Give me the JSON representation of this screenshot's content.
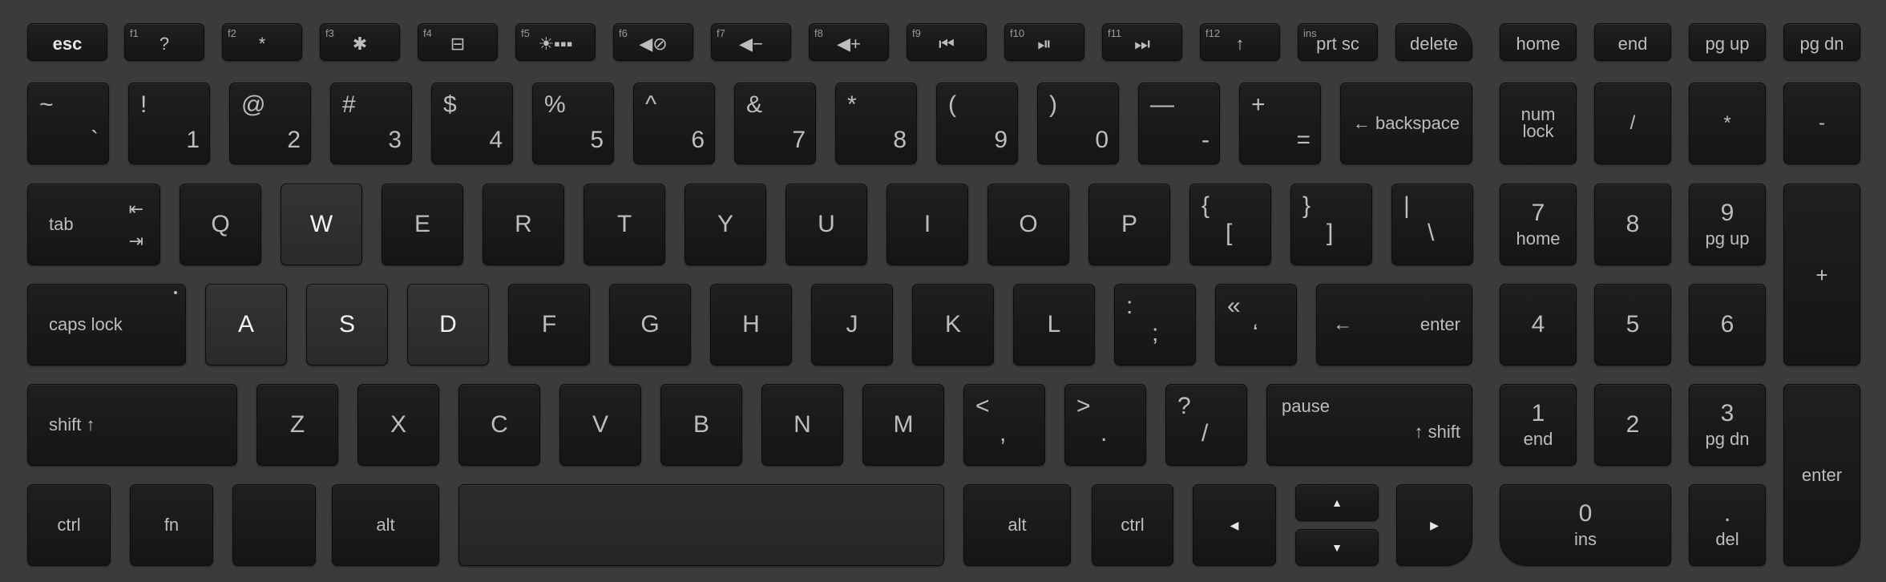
{
  "keyboard": {
    "fn_row": [
      {
        "id": "esc",
        "main": "esc"
      },
      {
        "id": "f1",
        "top": "f1",
        "main": "?"
      },
      {
        "id": "f2",
        "top": "f2",
        "main": "*"
      },
      {
        "id": "f3",
        "top": "f3",
        "main": "✱"
      },
      {
        "id": "f4",
        "top": "f4",
        "main": "⊟"
      },
      {
        "id": "f5",
        "top": "f5",
        "main": "☀▪▪▪"
      },
      {
        "id": "f6",
        "top": "f6",
        "main": "◀⊘"
      },
      {
        "id": "f7",
        "top": "f7",
        "main": "◀−"
      },
      {
        "id": "f8",
        "top": "f8",
        "main": "◀+"
      },
      {
        "id": "f9",
        "top": "f9",
        "main": "⏮"
      },
      {
        "id": "f10",
        "top": "f10",
        "main": "⏯"
      },
      {
        "id": "f11",
        "top": "f11",
        "main": "⏭"
      },
      {
        "id": "f12",
        "top": "f12",
        "main": "↑"
      },
      {
        "id": "ins-prtsc",
        "top": "ins",
        "main": "prt sc"
      },
      {
        "id": "delete",
        "main": "delete"
      },
      {
        "id": "home",
        "main": "home"
      },
      {
        "id": "end",
        "main": "end"
      },
      {
        "id": "pgup",
        "main": "pg up"
      },
      {
        "id": "pgdn",
        "main": "pg dn"
      }
    ],
    "num_row": [
      {
        "id": "backtick",
        "top": "~",
        "bottom": "`"
      },
      {
        "id": "1",
        "top": "!",
        "bottom": "1"
      },
      {
        "id": "2",
        "top": "@",
        "bottom": "2"
      },
      {
        "id": "3",
        "top": "#",
        "bottom": "3"
      },
      {
        "id": "4",
        "top": "$",
        "bottom": "4"
      },
      {
        "id": "5",
        "top": "%",
        "bottom": "5"
      },
      {
        "id": "6",
        "top": "^",
        "bottom": "6"
      },
      {
        "id": "7",
        "top": "&",
        "bottom": "7"
      },
      {
        "id": "8",
        "top": "*",
        "bottom": "8"
      },
      {
        "id": "9",
        "top": "(",
        "bottom": "9"
      },
      {
        "id": "0",
        "top": ")",
        "bottom": "0"
      },
      {
        "id": "minus",
        "top": "—",
        "bottom": "-"
      },
      {
        "id": "equals",
        "top": "+",
        "bottom": "="
      }
    ],
    "backspace": "← backspace",
    "tab": {
      "text": "tab",
      "arrows_top": "⇤",
      "arrows_bottom": "⇥"
    },
    "qrow": [
      "Q",
      "W",
      "E",
      "R",
      "T",
      "Y",
      "U",
      "I",
      "O",
      "P"
    ],
    "qrow_brackets": [
      {
        "id": "lbracket",
        "top": "{",
        "bottom": "["
      },
      {
        "id": "rbracket",
        "top": "}",
        "bottom": "]"
      },
      {
        "id": "backslash",
        "top": "|",
        "bottom": "\\"
      }
    ],
    "caps": "caps lock",
    "arow": [
      "A",
      "S",
      "D",
      "F",
      "G",
      "H",
      "J",
      "K",
      "L"
    ],
    "arow_punct": [
      {
        "id": "semicolon",
        "top": ":",
        "bottom": ";"
      },
      {
        "id": "quote",
        "top": "«",
        "bottom": "‘"
      }
    ],
    "enter": {
      "arrow": "←",
      "text": "enter"
    },
    "shift_left": "shift ↑",
    "zrow": [
      "Z",
      "X",
      "C",
      "V",
      "B",
      "N",
      "M"
    ],
    "zrow_punct": [
      {
        "id": "comma",
        "top": "<",
        "bottom": ","
      },
      {
        "id": "period",
        "top": ">",
        "bottom": "."
      },
      {
        "id": "slash",
        "top": "?",
        "bottom": "/"
      }
    ],
    "shift_right": {
      "top": "pause",
      "bottom": "↑ shift"
    },
    "bottom_row": {
      "ctrl_left": "ctrl",
      "fn": "fn",
      "blank": "",
      "alt_left": "alt",
      "alt_right": "alt",
      "ctrl_right": "ctrl",
      "left": "◀",
      "up": "▲",
      "down": "▼",
      "right": "▶"
    },
    "numpad": {
      "numlock": "num\nlock",
      "slash": "/",
      "star": "*",
      "minus": "-",
      "k7": {
        "main": "7",
        "sub": "home"
      },
      "k8": {
        "main": "8",
        "sub": ""
      },
      "k9": {
        "main": "9",
        "sub": "pg up"
      },
      "plus": "+",
      "k4": {
        "main": "4",
        "sub": ""
      },
      "k5": {
        "main": "5",
        "sub": ""
      },
      "k6": {
        "main": "6",
        "sub": ""
      },
      "k1": {
        "main": "1",
        "sub": "end"
      },
      "k2": {
        "main": "2",
        "sub": ""
      },
      "k3": {
        "main": "3",
        "sub": "pg dn"
      },
      "enter": "enter",
      "k0": {
        "main": "0",
        "sub": "ins"
      },
      "dot": {
        "main": ".",
        "sub": "del"
      }
    },
    "highlighted": [
      "W",
      "A",
      "S",
      "D"
    ],
    "colors": {
      "background": "#3b3b3b",
      "key": "#1a1a1a",
      "key_highlight": "#303030",
      "legend": "#bdbdbd"
    }
  }
}
